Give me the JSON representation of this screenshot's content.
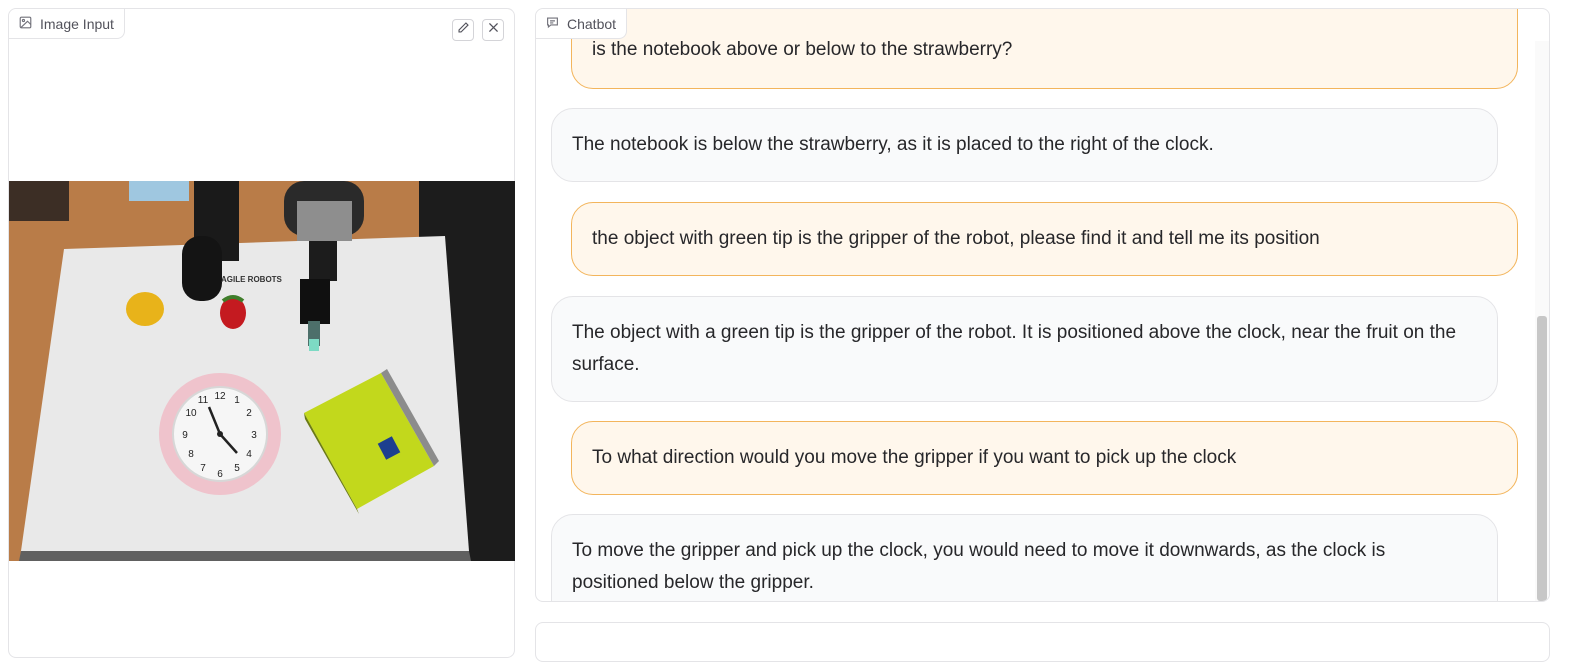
{
  "image_panel": {
    "label": "Image Input",
    "label_icon": "image-icon",
    "actions": [
      {
        "name": "edit",
        "icon": "pencil-icon"
      },
      {
        "name": "clear",
        "icon": "close-icon"
      }
    ],
    "photo": {
      "logo_text": "AGILE ROBOTS",
      "clock_numbers": [
        "12",
        "1",
        "2",
        "3",
        "4",
        "5",
        "6",
        "7",
        "8",
        "9",
        "10",
        "11"
      ]
    }
  },
  "chat_panel": {
    "label": "Chatbot",
    "label_icon": "chat-icon",
    "messages": [
      {
        "role": "user",
        "text": "is the notebook above or below to the strawberry?"
      },
      {
        "role": "bot",
        "text": "The notebook is below the strawberry, as it is placed to the right of the clock."
      },
      {
        "role": "user",
        "text": "the object with green tip is the gripper of the robot, please find it and tell me its position"
      },
      {
        "role": "bot",
        "text": "The object with a green tip is the gripper of the robot. It is positioned above the clock, near the fruit on the surface."
      },
      {
        "role": "user",
        "text": "To what direction would you move the gripper if you want to pick up the clock"
      },
      {
        "role": "bot",
        "text": "To move the gripper and pick up the clock, you would need to move it downwards, as the clock is positioned below the gripper."
      }
    ],
    "scroll_position": 0.51
  },
  "colors": {
    "user_bubble_bg": "#fff7ec",
    "user_bubble_border": "#f3b55c",
    "bot_bubble_bg": "#f9fafb",
    "panel_border": "#e4e4e7"
  }
}
